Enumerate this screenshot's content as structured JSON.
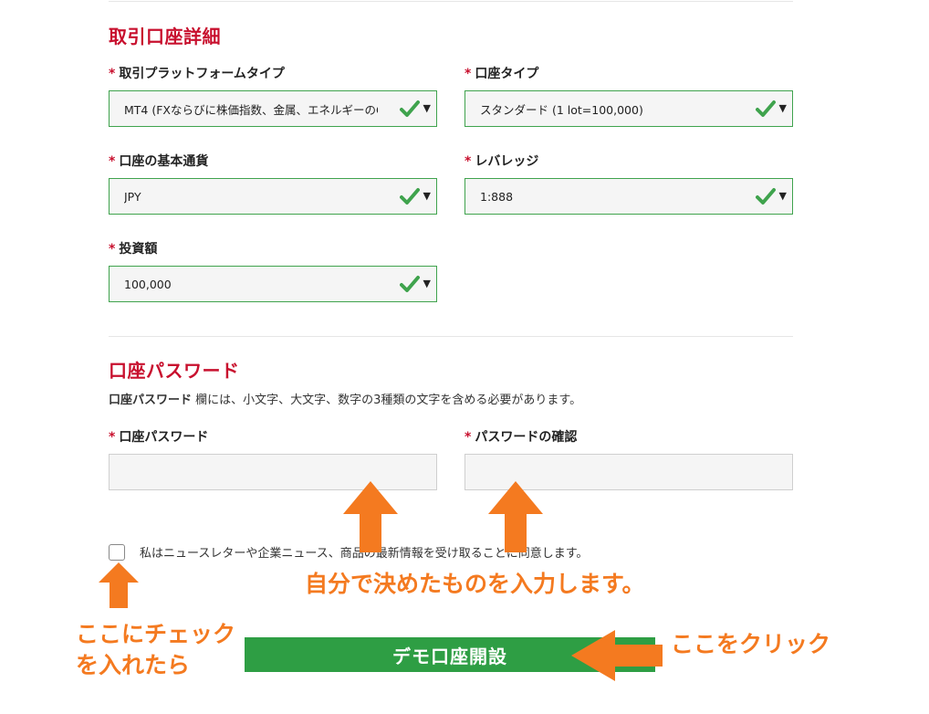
{
  "account_details": {
    "title": "取引口座詳細",
    "platform": {
      "label": "取引プラットフォームタイプ",
      "value": "MT4 (FXならびに株価指数、金属、エネルギーのCFD"
    },
    "account_type": {
      "label": "口座タイプ",
      "value": "スタンダード (1 lot=100,000)"
    },
    "base_currency": {
      "label": "口座の基本通貨",
      "value": "JPY"
    },
    "leverage": {
      "label": "レバレッジ",
      "value": "1:888"
    },
    "investment": {
      "label": "投資額",
      "value": "100,000"
    },
    "required_mark": "*"
  },
  "password_section": {
    "title": "口座パスワード",
    "note_bold": "口座パスワード",
    "note_rest": " 欄には、小文字、大文字、数字の3種類の文字を含める必要があります。",
    "password_label": "口座パスワード",
    "confirm_label": "パスワードの確認"
  },
  "consent": {
    "text": "私はニュースレターや企業ニュース、商品の最新情報を受け取ることに同意します。"
  },
  "submit": {
    "label": "デモ口座開設"
  },
  "annotations": {
    "input_hint": "自分で決めたものを入力します。",
    "check_hint_line1": "ここにチェック",
    "check_hint_line2": "を入れたら",
    "click_hint": "ここをクリック",
    "color": "#f47a20"
  },
  "colors": {
    "accent_red": "#c8102e",
    "valid_green": "#3fa34d",
    "button_green": "#2e9e44"
  },
  "icons": {
    "valid": "checkmark-icon",
    "dropdown": "caret-down-icon"
  }
}
